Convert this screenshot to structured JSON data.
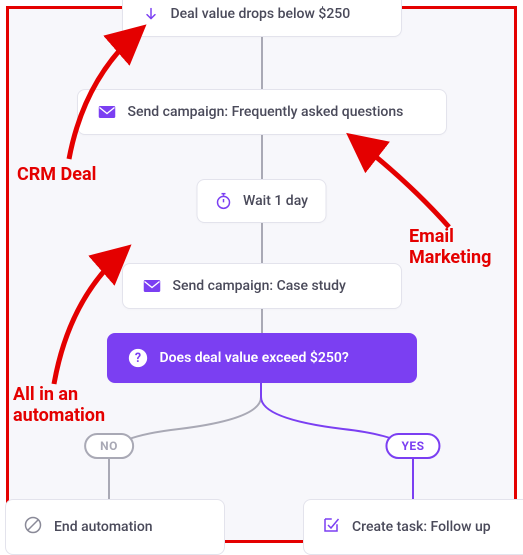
{
  "automation": {
    "trigger": {
      "label": "Deal value drops below $250"
    },
    "step1": {
      "label": "Send campaign: Frequently asked questions"
    },
    "wait": {
      "label": "Wait 1 day"
    },
    "step2": {
      "label": "Send campaign: Case study"
    },
    "decision": {
      "label": "Does deal value exceed $250?"
    },
    "branches": {
      "no_label": "NO",
      "yes_label": "YES",
      "no_action": "End automation",
      "yes_action": "Create task: Follow up"
    }
  },
  "annotations": {
    "crm_deal": "CRM Deal",
    "email_marketing": "Email\nMarketing",
    "all_in": "All in an\nautomation"
  },
  "colors": {
    "accent": "#7b3ff2",
    "annotation": "#e40000",
    "line": "#a9a9b5"
  }
}
